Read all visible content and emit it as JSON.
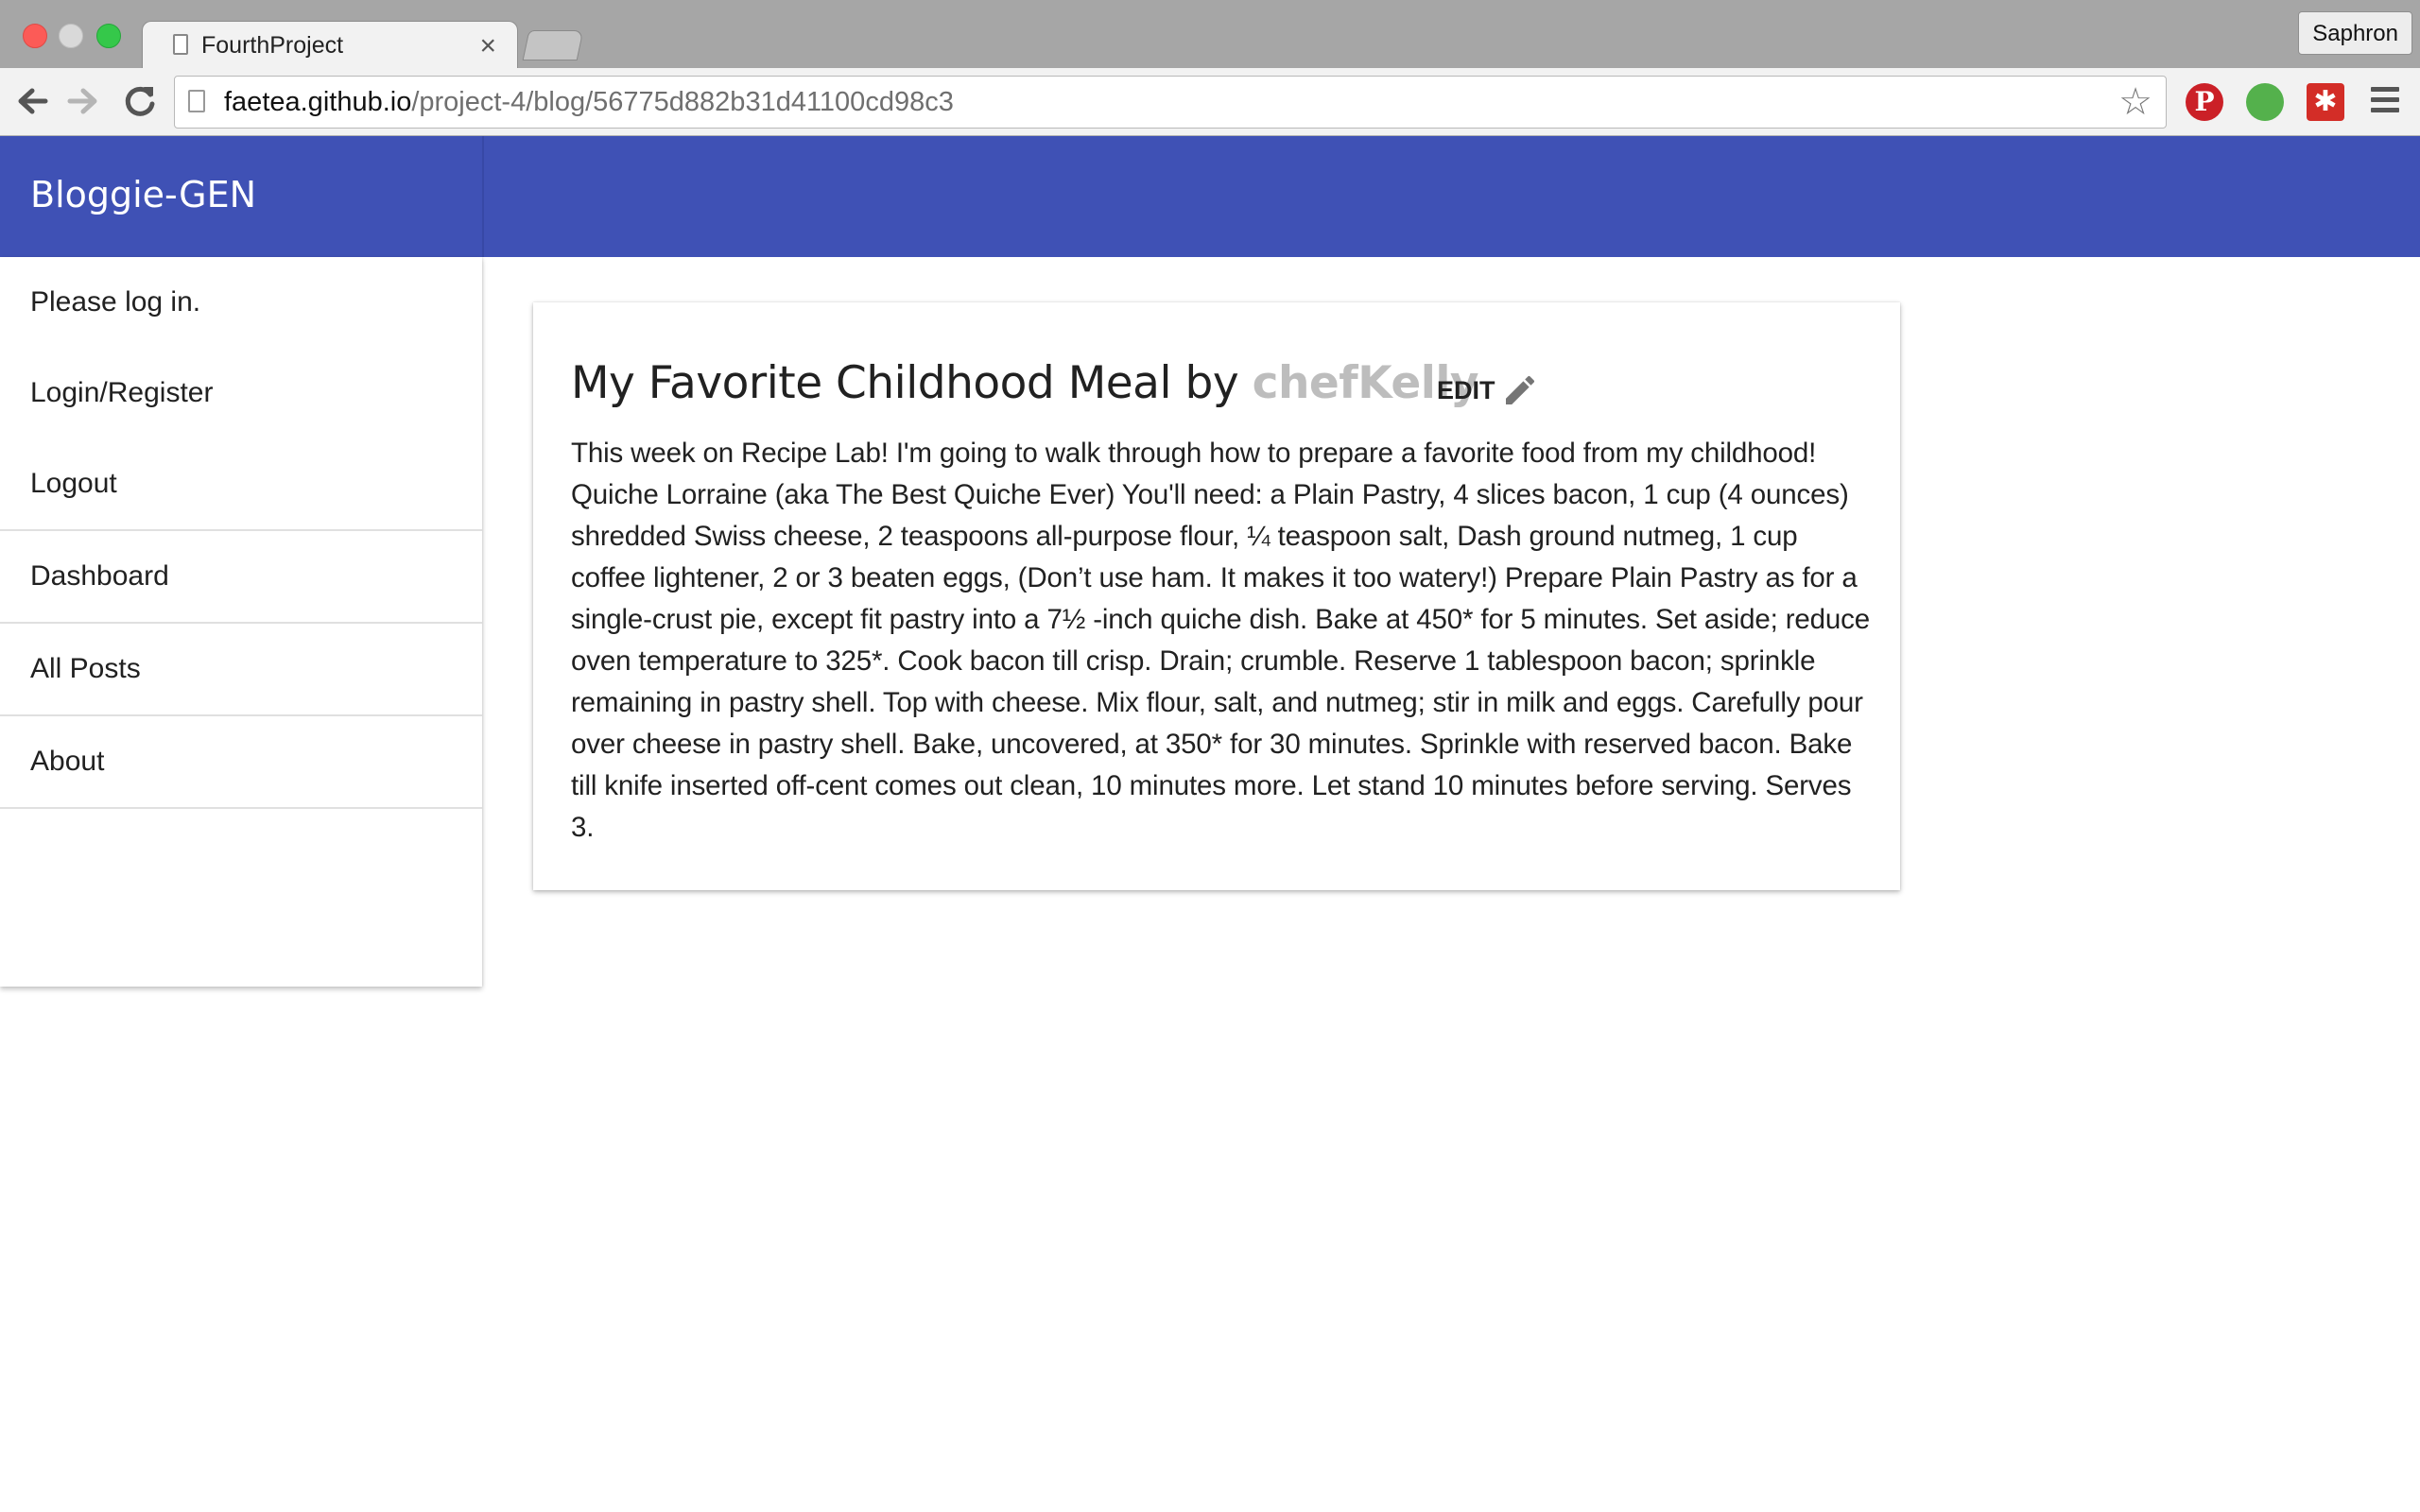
{
  "browser": {
    "tab_title": "FourthProject",
    "tab_close": "×",
    "profile_name": "Saphron",
    "url_host": "faetea.github.io",
    "url_path": "/project-4/blog/56775d882b31d41100cd98c3",
    "icons": [
      "back-icon",
      "forward-icon",
      "reload-icon",
      "page-icon",
      "star-icon",
      "pinterest-icon",
      "evernote-icon",
      "lastpass-icon",
      "menu-icon"
    ]
  },
  "app": {
    "brand": "Bloggie-GEN",
    "accent_color": "#3f51b5"
  },
  "drawer": {
    "items": [
      {
        "label": "Please log in."
      },
      {
        "label": "Login/Register"
      },
      {
        "label": "Logout"
      },
      {
        "label": "Dashboard"
      },
      {
        "label": "All Posts"
      },
      {
        "label": "About"
      }
    ]
  },
  "post": {
    "title": "My Favorite Childhood Meal",
    "by": "by",
    "author": "chefKelly",
    "edit_label": "EDIT",
    "body": "This week on Recipe Lab! I'm going to walk through how to prepare a favorite food from my childhood! Quiche Lorraine (aka The Best Quiche Ever) You'll need: a Plain Pastry, 4 slices bacon, 1 cup (4 ounces) shredded Swiss cheese, 2 teaspoons all-purpose flour, ¼ teaspoon salt, Dash ground nutmeg, 1 cup coffee lightener, 2 or 3 beaten eggs, (Don’t use ham. It makes it too watery!) Prepare Plain Pastry as for a single-crust pie, except fit pastry into a 7½ -inch quiche dish. Bake at 450* for 5 minutes. Set aside; reduce oven temperature to 325*. Cook bacon till crisp. Drain; crumble. Reserve 1 tablespoon bacon; sprinkle remaining in pastry shell. Top with cheese. Mix flour, salt, and nutmeg; stir in milk and eggs. Carefully pour over cheese in pastry shell. Bake, uncovered, at 350* for 30 minutes. Sprinkle with reserved bacon. Bake till knife inserted off-cent comes out clean, 10 minutes more. Let stand 10 minutes before serving. Serves 3."
  }
}
